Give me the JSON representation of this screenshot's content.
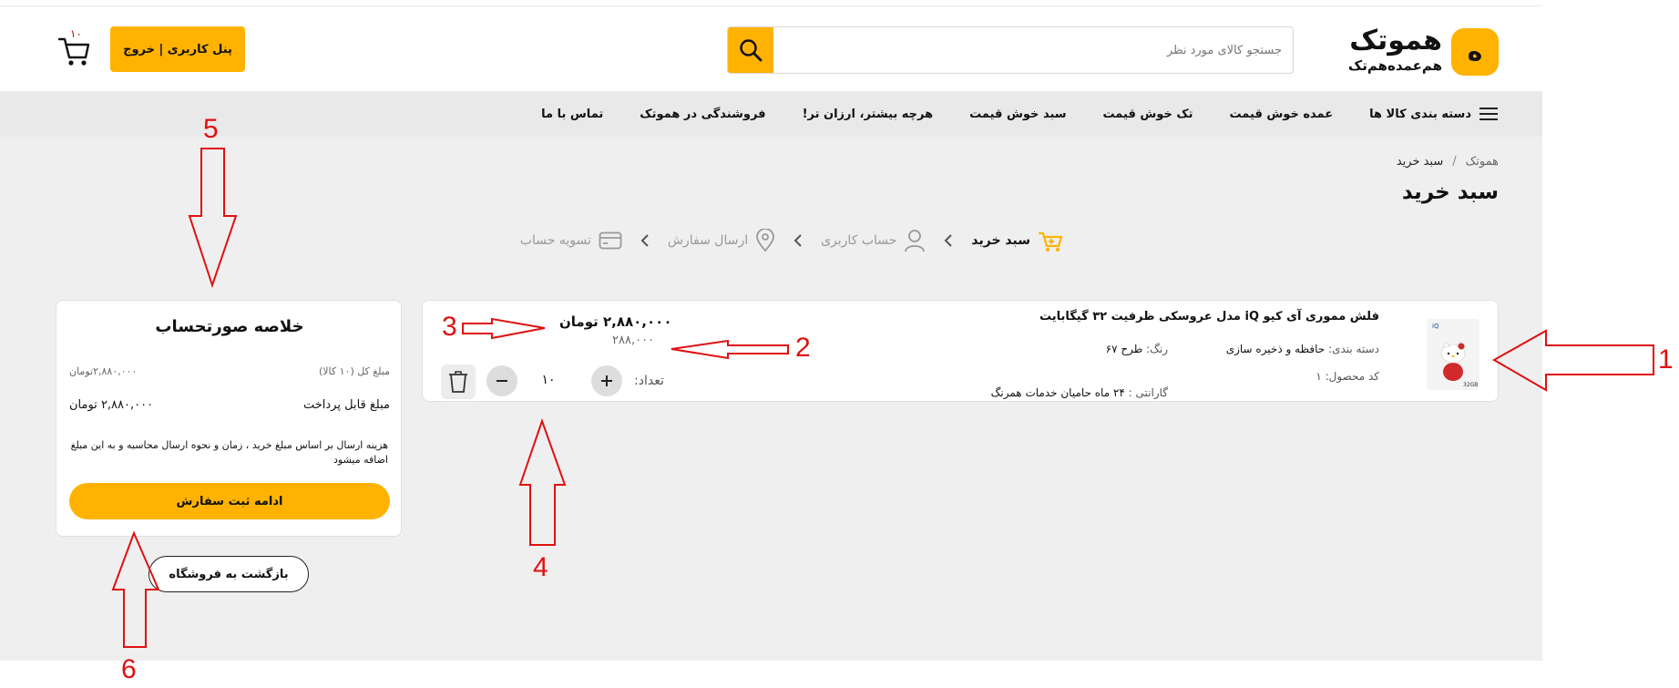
{
  "header": {
    "logo_badge": "ه",
    "logo_title": "هموتک",
    "logo_sub": "هم‌عمده‌هم‌تک",
    "search_placeholder": "جستجو کالای مورد نظر",
    "panel_label": "پنل کاربری | خروج",
    "cart_count": "۱۰"
  },
  "nav": {
    "items": [
      "دسته بندی کالا ها",
      "عمده خوش قیمت",
      "تک خوش قیمت",
      "سبد خوش قیمت",
      "هرچه بیشتر، ارزان تر!",
      "فروشندگی در هموتک",
      "تماس با ما"
    ]
  },
  "breadcrumb": {
    "home": "هموتک",
    "sep": "/",
    "current": "سبد خرید"
  },
  "page_title": "سبد خرید",
  "steps": [
    {
      "label": "سبد خرید",
      "active": true
    },
    {
      "label": "حساب کاربری",
      "active": false
    },
    {
      "label": "ارسال سفارش",
      "active": false
    },
    {
      "label": "تسویه حساب",
      "active": false
    }
  ],
  "product": {
    "title": "فلش مموری آی کیو iQ مدل عروسکی ظرفیت ۳۲ گیگابایت",
    "category_label": "دسته بندی:",
    "category_value": "حافظه و ذخیره سازی",
    "color_label": "رنگ:",
    "color_value": "طرح ۶۷",
    "code_label": "کد محصول: ۱",
    "warranty_label": "گارانتی :",
    "warranty_value": "۲۴ ماه حامیان خدمات همرنگ",
    "price": "۲,۸۸۰,۰۰۰ تومان",
    "unit_price": "۲۸۸,۰۰۰",
    "qty_label": "تعداد:",
    "qty_value": "۱۰",
    "img_brand": "iQ",
    "img_capacity": "32GB"
  },
  "summary": {
    "title": "خلاصه صورتحساب",
    "total_label": "مبلغ کل (۱۰ کالا)",
    "total_value": "۲,۸۸۰,۰۰۰تومان",
    "payable_label": "مبلغ قابل پرداخت",
    "payable_value": "۲,۸۸۰,۰۰۰ تومان",
    "note": "هزینه ارسال بر اساس مبلغ خرید ، زمان و نحوه ارسال محاسبه و به این مبلغ اضافه میشود",
    "continue_label": "ادامه ثبت سفارش"
  },
  "back_label": "بازگشت به فروشگاه",
  "annotations": {
    "n1": "1",
    "n2": "2",
    "n3": "3",
    "n4": "4",
    "n5": "5",
    "n6": "6",
    "color": "#e01010"
  },
  "colors": {
    "accent": "#FFB300",
    "nav_bg": "#e9e9e9",
    "content_bg": "#efefef"
  }
}
